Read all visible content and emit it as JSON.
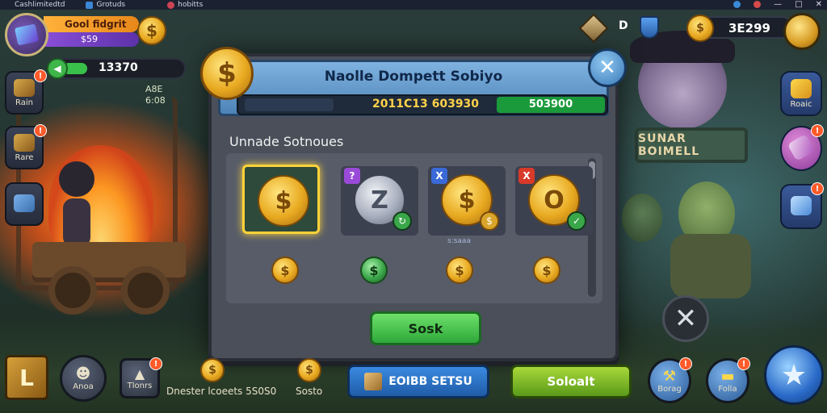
{
  "window": {
    "app_name": "Cashlimitedtd",
    "tab2": "Grotuds",
    "tab3_tail": "hobitts",
    "controls": [
      "—",
      "□",
      "✕"
    ]
  },
  "player": {
    "name": "Gool fidgrit",
    "sub_value": "$59",
    "xp_value": "13370",
    "stats_line1": "A8E",
    "stats_line2": "6:08"
  },
  "left_buttons": [
    {
      "label": "Rain",
      "badge": "!"
    },
    {
      "label": "Rare",
      "badge": "!"
    },
    {
      "label": ""
    }
  ],
  "top_right": {
    "d_label": "D",
    "currency_value": "3E299"
  },
  "right_buttons": [
    {
      "label": "Roaic",
      "badge": ""
    },
    {
      "label": "",
      "badge": "!"
    },
    {
      "label": "",
      "badge": "!"
    }
  ],
  "modal": {
    "title": "Naolle Dompett Sobiyo",
    "info_mid": "2011C13 603930",
    "info_green": "503900",
    "section_label": "Unnade Sotnoues",
    "tiles": [
      {
        "name": "gold-gem-coin",
        "selected": true,
        "corner": "",
        "caption": ""
      },
      {
        "name": "silver-coin",
        "selected": false,
        "corner": "?",
        "caption": ""
      },
      {
        "name": "gold-dollar-coin",
        "selected": false,
        "corner": "X",
        "caption": "s:saaa"
      },
      {
        "name": "gold-o-coin",
        "selected": false,
        "corner": "X",
        "caption": ""
      }
    ],
    "select_button": "Sosk"
  },
  "bottom": {
    "left_btn_glyph": "L",
    "round1_label": "Anoa",
    "round2_label": "Tlonrs",
    "info_text": "Dnester lcoeets 5S0S0",
    "round3_label": "Sosto",
    "blue_btn": "EOIBB SETSU",
    "lime_btn": "Soloalt",
    "right1_label": "Borag",
    "right2_label": "Folla"
  },
  "scene": {
    "sign_text": "SUNAR BOIMELL"
  },
  "colors": {
    "modal_bg": "#4a4f5a",
    "header_blue": "#7fb2e0",
    "gold": "#e8a920",
    "green_btn": "#2ea83a",
    "badge_red": "#ff5a2a"
  }
}
